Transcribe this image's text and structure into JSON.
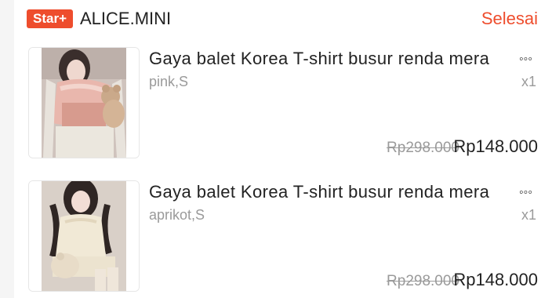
{
  "shop": {
    "badge": "Star+",
    "name": "ALICE.MINI",
    "status": "Selesai"
  },
  "items": [
    {
      "title": "Gaya balet Korea T-shirt busur renda mera",
      "more": "◦◦◦",
      "variant": "pink,S",
      "qty": "x1",
      "old_price": "Rp298.000",
      "price": "Rp148.000",
      "image": "product-photo-pink-top"
    },
    {
      "title": "Gaya balet Korea T-shirt busur renda mera",
      "more": "◦◦◦",
      "variant": "aprikot,S",
      "qty": "x1",
      "old_price": "Rp298.000",
      "price": "Rp148.000",
      "image": "product-photo-apricot-top"
    }
  ],
  "colors": {
    "accent": "#ee4d2d",
    "muted": "#9a9a9a",
    "text": "#222222"
  }
}
